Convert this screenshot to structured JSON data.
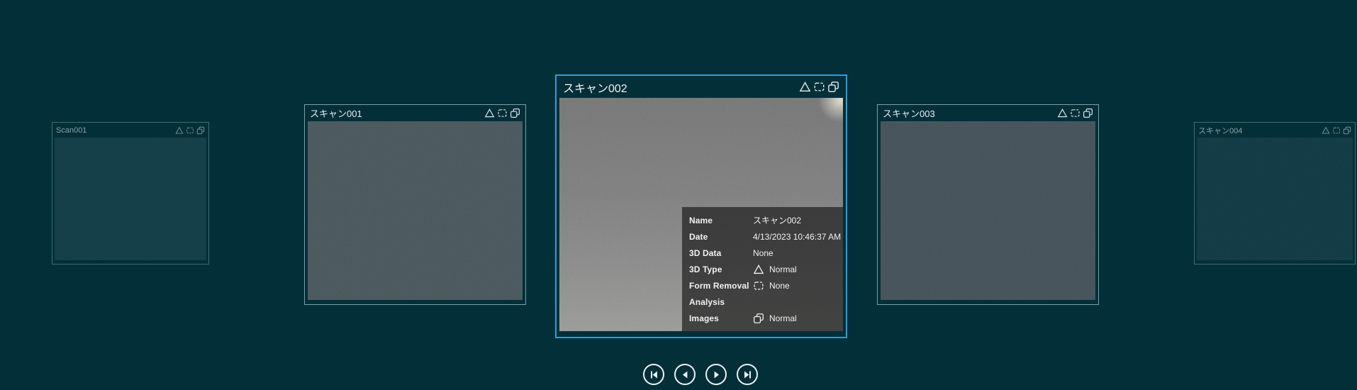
{
  "page": {
    "background_color": "#032f39",
    "accent_color": "#2f9ed8"
  },
  "carousel": {
    "cards": [
      {
        "name": "Scan001",
        "state": "far-left",
        "status_icons": [
          "3d-type-icon",
          "form-removal-icon",
          "images-icon"
        ]
      },
      {
        "name": "スキャン001",
        "state": "left",
        "status_icons": [
          "3d-type-icon",
          "form-removal-icon",
          "images-icon"
        ]
      },
      {
        "name": "スキャン002",
        "state": "selected",
        "status_icons": [
          "3d-type-icon",
          "form-removal-icon",
          "images-icon"
        ]
      },
      {
        "name": "スキャン003",
        "state": "right",
        "status_icons": [
          "3d-type-icon",
          "form-removal-icon",
          "images-icon"
        ]
      },
      {
        "name": "スキャン004",
        "state": "far-right",
        "status_icons": [
          "3d-type-icon",
          "form-removal-icon",
          "images-icon"
        ]
      }
    ]
  },
  "tooltip": {
    "rows": [
      {
        "label": "Name",
        "value": "スキャン002",
        "icon": ""
      },
      {
        "label": "Date",
        "value": "4/13/2023 10:46:37 AM",
        "icon": ""
      },
      {
        "label": "3D Data",
        "value": "None",
        "icon": ""
      },
      {
        "label": "3D Type",
        "value": "Normal",
        "icon": "triangle-icon"
      },
      {
        "label": "Form Removal",
        "value": "None",
        "icon": "form-removal-icon"
      },
      {
        "label": "Analysis",
        "value": "",
        "icon": ""
      },
      {
        "label": "Images",
        "value": "Normal",
        "icon": "images-icon"
      }
    ]
  },
  "navigation": {
    "buttons": [
      {
        "name": "first"
      },
      {
        "name": "previous"
      },
      {
        "name": "next"
      },
      {
        "name": "last"
      }
    ]
  }
}
